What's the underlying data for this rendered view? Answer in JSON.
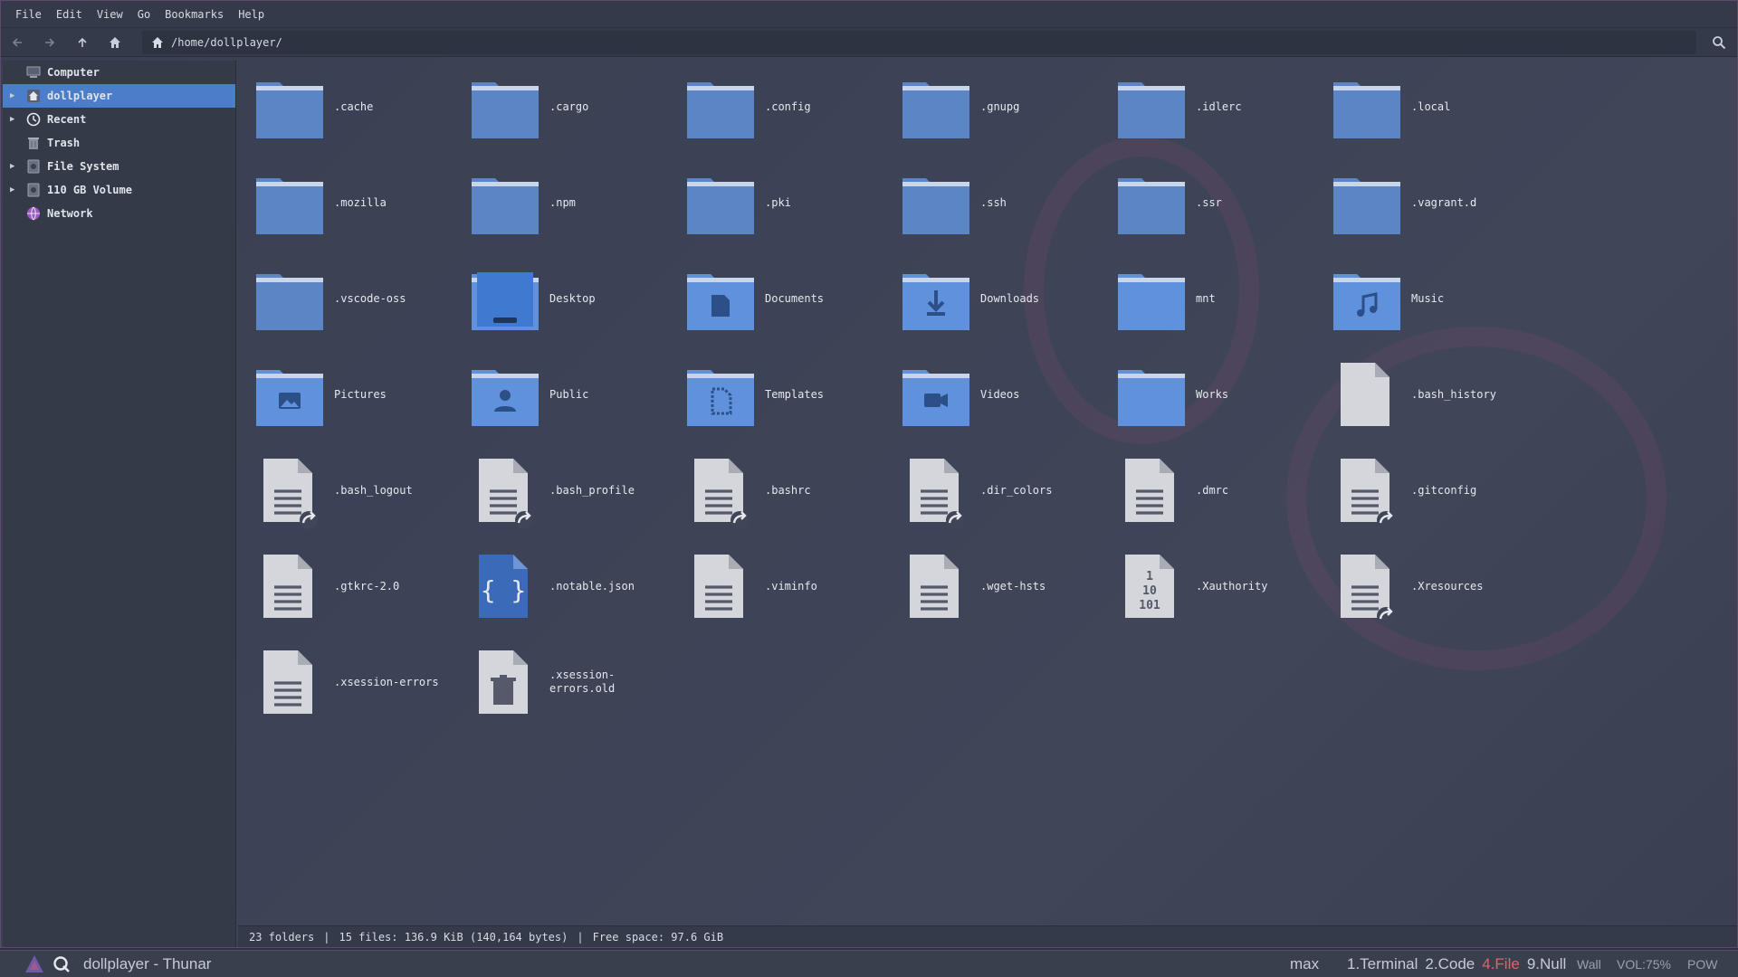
{
  "menubar": {
    "items": [
      "File",
      "Edit",
      "View",
      "Go",
      "Bookmarks",
      "Help"
    ]
  },
  "toolbar": {
    "path": "/home/dollplayer/"
  },
  "sidebar": {
    "items": [
      {
        "label": "Computer",
        "icon": "computer-icon",
        "expander": false,
        "selected": false
      },
      {
        "label": "dollplayer",
        "icon": "home-icon",
        "expander": true,
        "selected": true
      },
      {
        "label": "Recent",
        "icon": "clock-icon",
        "expander": true,
        "selected": false
      },
      {
        "label": "Trash",
        "icon": "trash-icon",
        "expander": false,
        "selected": false
      },
      {
        "label": "File System",
        "icon": "drive-icon",
        "expander": true,
        "selected": false
      },
      {
        "label": "110 GB Volume",
        "icon": "drive-icon",
        "expander": true,
        "selected": false
      },
      {
        "label": "Network",
        "icon": "network-icon",
        "expander": false,
        "selected": false
      }
    ]
  },
  "files": [
    {
      "name": ".cache",
      "kind": "folder"
    },
    {
      "name": ".cargo",
      "kind": "folder"
    },
    {
      "name": ".config",
      "kind": "folder"
    },
    {
      "name": ".gnupg",
      "kind": "folder"
    },
    {
      "name": ".idlerc",
      "kind": "folder"
    },
    {
      "name": ".local",
      "kind": "folder"
    },
    {
      "name": ".mozilla",
      "kind": "folder"
    },
    {
      "name": ".npm",
      "kind": "folder"
    },
    {
      "name": ".pki",
      "kind": "folder"
    },
    {
      "name": ".ssh",
      "kind": "folder"
    },
    {
      "name": ".ssr",
      "kind": "folder"
    },
    {
      "name": ".vagrant.d",
      "kind": "folder"
    },
    {
      "name": ".vscode-oss",
      "kind": "folder"
    },
    {
      "name": "Desktop",
      "kind": "folder-desktop"
    },
    {
      "name": "Documents",
      "kind": "folder-documents"
    },
    {
      "name": "Downloads",
      "kind": "folder-downloads"
    },
    {
      "name": "mnt",
      "kind": "folder-bright"
    },
    {
      "name": "Music",
      "kind": "folder-music"
    },
    {
      "name": "Pictures",
      "kind": "folder-pictures"
    },
    {
      "name": "Public",
      "kind": "folder-public"
    },
    {
      "name": "Templates",
      "kind": "folder-templates"
    },
    {
      "name": "Videos",
      "kind": "folder-videos"
    },
    {
      "name": "Works",
      "kind": "folder-bright"
    },
    {
      "name": ".bash_history",
      "kind": "file-blank"
    },
    {
      "name": ".bash_logout",
      "kind": "file-text-link"
    },
    {
      "name": ".bash_profile",
      "kind": "file-text-link"
    },
    {
      "name": ".bashrc",
      "kind": "file-text-link"
    },
    {
      "name": ".dir_colors",
      "kind": "file-text-link"
    },
    {
      "name": ".dmrc",
      "kind": "file-text"
    },
    {
      "name": ".gitconfig",
      "kind": "file-text-link"
    },
    {
      "name": ".gtkrc-2.0",
      "kind": "file-text"
    },
    {
      "name": ".notable.json",
      "kind": "file-json"
    },
    {
      "name": ".viminfo",
      "kind": "file-text"
    },
    {
      "name": ".wget-hsts",
      "kind": "file-text"
    },
    {
      "name": ".Xauthority",
      "kind": "file-binary"
    },
    {
      "name": ".Xresources",
      "kind": "file-text-link"
    },
    {
      "name": ".xsession-errors",
      "kind": "file-text"
    },
    {
      "name": ".xsession-\nerrors.old",
      "kind": "file-trash"
    }
  ],
  "status": {
    "folders": "23 folders",
    "files": "15 files: 136.9 KiB (140,164 bytes)",
    "free": "Free space: 97.6 GiB"
  },
  "taskbar": {
    "title": "dollplayer - Thunar",
    "layout": "max",
    "workspaces": [
      "1.Terminal",
      "2.Code",
      "4.File",
      "9.Null"
    ],
    "active_workspace": "4.File",
    "wall": "Wall",
    "volume": "VOL:75%",
    "power": "POW"
  },
  "colors": {
    "folder": "#5b85c4",
    "folder_bright": "#5f91dd",
    "selection": "#4a7ec8",
    "accent": "#e0626a"
  }
}
